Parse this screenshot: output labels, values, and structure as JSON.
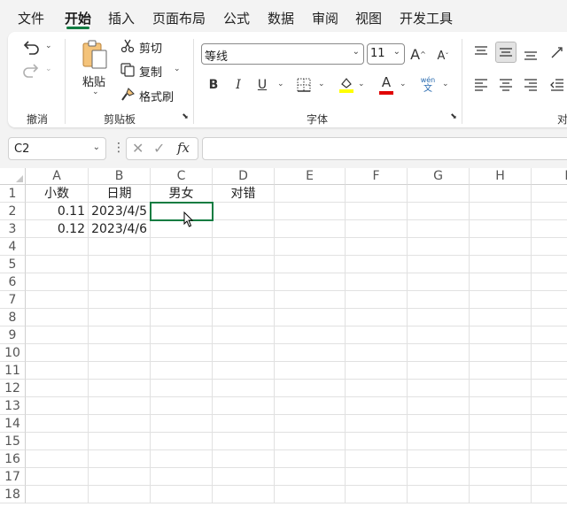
{
  "menu": {
    "tabs": [
      "文件",
      "开始",
      "插入",
      "页面布局",
      "公式",
      "数据",
      "审阅",
      "视图",
      "开发工具"
    ],
    "active": "开始"
  },
  "ribbon": {
    "undo_group": {
      "label": "撤消",
      "undo_icon": "undo-icon",
      "redo_icon": "redo-icon"
    },
    "clipboard": {
      "label": "剪贴板",
      "paste_label": "粘贴",
      "cut_label": "剪切",
      "copy_label": "复制",
      "format_painter_label": "格式刷"
    },
    "font": {
      "label": "字体",
      "font_name": "等线",
      "font_size": "11",
      "bold": "B",
      "italic": "I",
      "underline": "U",
      "wen_top": "wén",
      "wen_bottom": "文",
      "grow": "A",
      "shrink": "A",
      "font_color_letter": "A",
      "highlight_color": "#ffff00",
      "font_color": "#e00000"
    },
    "alignment_label_partial": "对"
  },
  "formula_bar": {
    "name_box": "C2",
    "fx": "fx",
    "formula": ""
  },
  "sheet": {
    "columns": [
      "A",
      "B",
      "C",
      "D",
      "E",
      "F",
      "G",
      "H",
      "I"
    ],
    "rows": [
      "1",
      "2",
      "3",
      "4",
      "5",
      "6",
      "7",
      "8",
      "9",
      "10",
      "11",
      "12",
      "13",
      "14",
      "15",
      "16",
      "17",
      "18"
    ],
    "cells": {
      "A1": "小数",
      "B1": "日期",
      "C1": "男女",
      "D1": "对错",
      "A2": "0.11",
      "B2": "2023/4/5",
      "A3": "0.12",
      "B3": "2023/4/6"
    },
    "selected": "C2"
  },
  "colors": {
    "accent": "#107c41"
  }
}
